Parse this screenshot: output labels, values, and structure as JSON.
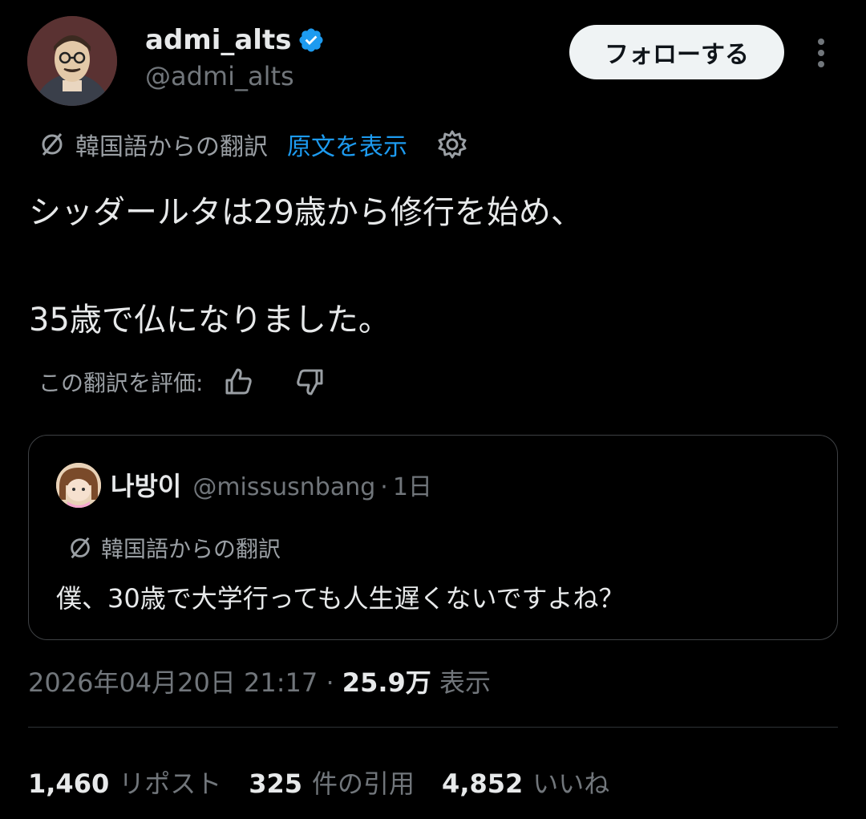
{
  "author": {
    "display_name": "admi_alts",
    "handle": "@admi_alts",
    "verified_color": "#1d9bf0"
  },
  "follow_button": {
    "label": "フォローする"
  },
  "translation": {
    "source_label": "韓国語からの翻訳",
    "show_original": "原文を表示"
  },
  "tweet": {
    "line1": "シッダールタは29歳から修行を始め、",
    "line2": "35歳で仏になりました。"
  },
  "rating": {
    "label": "この翻訳を評価:"
  },
  "quote": {
    "display_name": "나방이",
    "handle": "@missusnbang",
    "separator": "·",
    "time": "1日",
    "translation_label": "韓国語からの翻訳",
    "text": "僕、30歳で大学行っても人生遅くないですよね？"
  },
  "meta": {
    "timestamp": "2026年04月20日 21:17",
    "separator": " · ",
    "views_count": "25.9万",
    "views_label": "表示"
  },
  "stats": [
    {
      "count": "1,460",
      "label": "リポスト"
    },
    {
      "count": "325",
      "label": "件の引用"
    },
    {
      "count": "4,852",
      "label": "いいね"
    }
  ],
  "colors": {
    "background": "#000000",
    "text": "#e7e9ea",
    "muted": "#71767b",
    "accent": "#1d9bf0",
    "border": "#2f3336"
  }
}
